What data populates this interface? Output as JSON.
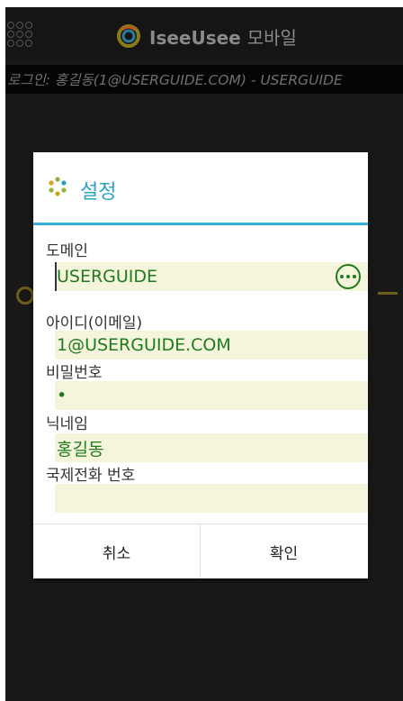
{
  "header": {
    "app_name": "IseeUsee",
    "app_name_suffix": "모바일",
    "login_info": "로그인: 홍길동(1@USERGUIDE.COM) - USERGUIDE"
  },
  "dialog": {
    "title": "설정",
    "fields": {
      "domain": {
        "label": "도메인",
        "value": "USERGUIDE"
      },
      "user_id": {
        "label": "아이디(이메일)",
        "value": "1@USERGUIDE.COM"
      },
      "password": {
        "label": "비밀번호",
        "value": "•"
      },
      "nickname": {
        "label": "닉네임",
        "value": "홍길동"
      },
      "intl_phone": {
        "label": "국제전화 번호",
        "value": ""
      }
    },
    "buttons": {
      "cancel": "취소",
      "ok": "확인"
    }
  },
  "colors": {
    "accent": "#34aedb",
    "field_text": "#1f7a1f",
    "field_bg": "#f5f5dc"
  }
}
